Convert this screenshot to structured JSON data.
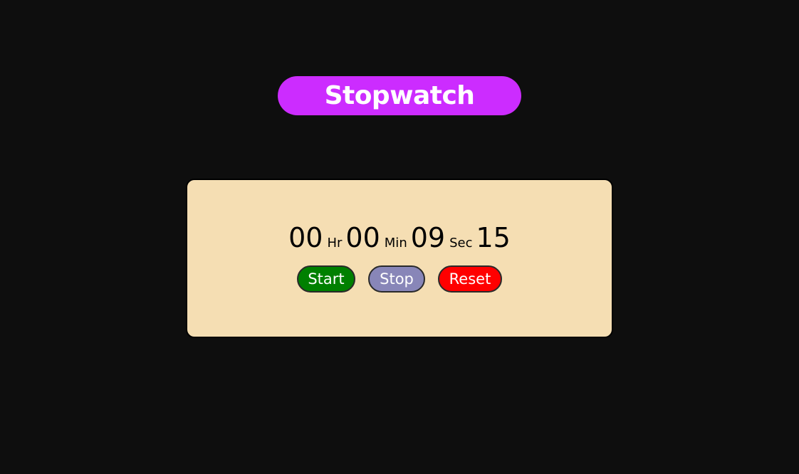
{
  "header": {
    "title": "Stopwatch"
  },
  "timer": {
    "hours": "00",
    "hours_label": "Hr",
    "minutes": "00",
    "minutes_label": "Min",
    "seconds": "09",
    "seconds_label": "Sec",
    "centiseconds": "15"
  },
  "controls": {
    "start_label": "Start",
    "stop_label": "Stop",
    "reset_label": "Reset"
  },
  "colors": {
    "background": "#0e0e0e",
    "title_pill": "#cc2cff",
    "card": "#f5deb3",
    "start": "#008000",
    "stop": "#8886b8",
    "reset": "#ff0000"
  }
}
